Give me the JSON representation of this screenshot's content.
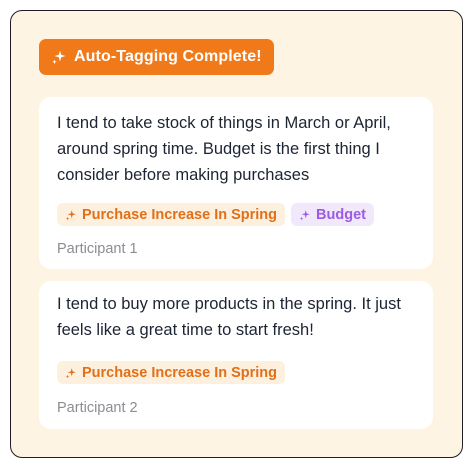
{
  "badge": {
    "label": "Auto-Tagging Complete!",
    "icon": "sparkle-icon",
    "color": "#f07a1a"
  },
  "cards": [
    {
      "quote": "I tend to take stock of things in March or April, around spring time. Budget is the first thing I consider before making purchases",
      "tags": [
        {
          "label": "Purchase Increase In Spring",
          "icon": "sparkle-icon",
          "color": "#e0701a"
        },
        {
          "label": "Budget",
          "icon": "sparkle-icon",
          "color": "#9b5ce3"
        }
      ],
      "participant": "Participant 1"
    },
    {
      "quote": "I tend to buy more products in the spring. It just feels like a great time to start fresh!",
      "tags": [
        {
          "label": "Purchase Increase In Spring",
          "icon": "sparkle-icon",
          "color": "#e0701a"
        }
      ],
      "participant": "Participant 2"
    }
  ]
}
